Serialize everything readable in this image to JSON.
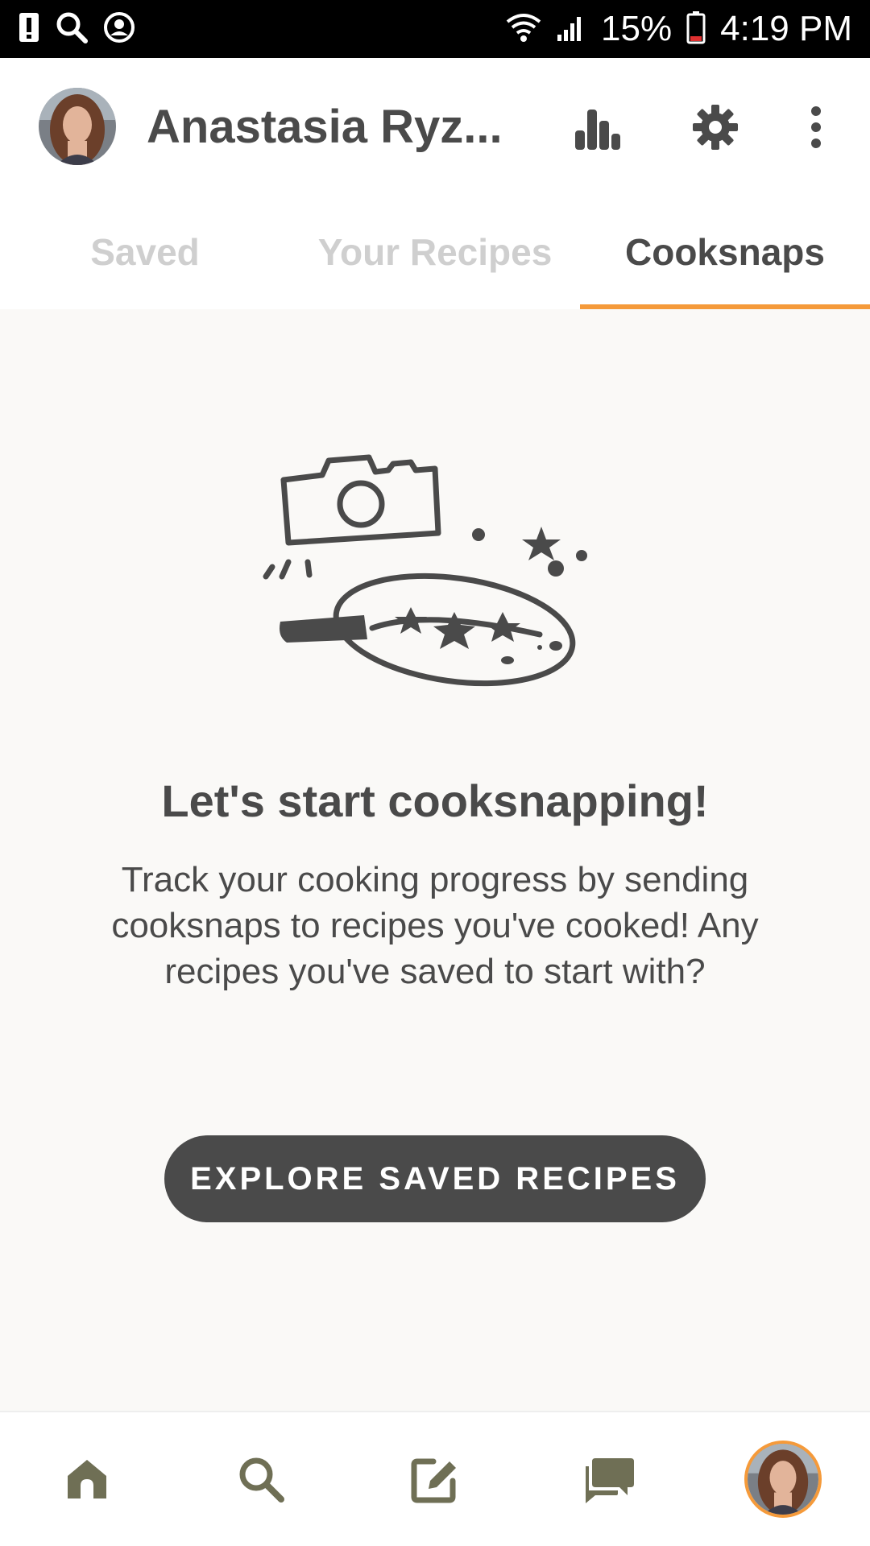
{
  "status_bar": {
    "battery_percent": "15%",
    "time": "4:19 PM",
    "icons": [
      "alert-icon",
      "search-icon",
      "account-circle-icon",
      "wifi-icon",
      "signal-icon",
      "battery-icon"
    ]
  },
  "header": {
    "profile_name": "Anastasia Ryz...",
    "icons": [
      "avatar",
      "stats-icon",
      "gear-icon",
      "more-vert-icon"
    ]
  },
  "tabs": [
    {
      "label": "Saved",
      "active": false
    },
    {
      "label": "Your Recipes",
      "active": false
    },
    {
      "label": "Cooksnaps",
      "active": true
    }
  ],
  "empty_state": {
    "title": "Let's start cooksnapping!",
    "body": "Track your cooking progress by sending cooksnaps to recipes you've cooked! Any recipes you've saved to start with?",
    "button_label": "EXPLORE SAVED RECIPES",
    "illustration": "camera-pan-illustration"
  },
  "bottom_nav": {
    "items": [
      "home-icon",
      "search-icon",
      "edit-icon",
      "chat-icon",
      "profile-avatar"
    ]
  },
  "colors": {
    "accent": "#f59a3a",
    "text": "#4a4a4a",
    "inactive_tab": "#cfcfcf",
    "nav_icon": "#6f6f55",
    "background": "#faf9f7"
  }
}
